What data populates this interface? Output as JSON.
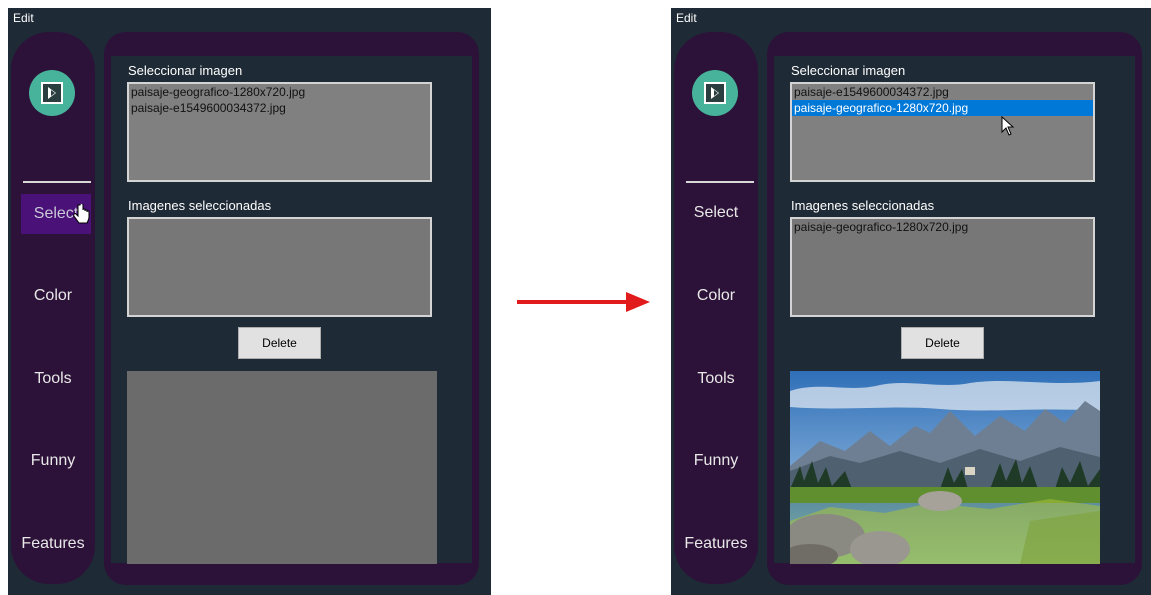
{
  "before": {
    "menu": "Edit",
    "nav": [
      "Select",
      "Color",
      "Tools",
      "Funny",
      "Features"
    ],
    "select_label": "Seleccionar imagen",
    "select_items": [
      "paisaje-geografico-1280x720.jpg",
      "paisaje-e1549600034372.jpg"
    ],
    "selected_label": "Imagenes seleccionadas",
    "selected_items": [],
    "delete_label": "Delete"
  },
  "after": {
    "menu": "Edit",
    "nav": [
      "Select",
      "Color",
      "Tools",
      "Funny",
      "Features"
    ],
    "select_label": "Seleccionar imagen",
    "select_items": [
      "paisaje-e1549600034372.jpg",
      "paisaje-geografico-1280x720.jpg"
    ],
    "highlighted_item": "paisaje-geografico-1280x720.jpg",
    "selected_label": "Imagenes seleccionadas",
    "selected_items": [
      "paisaje-geografico-1280x720.jpg"
    ],
    "delete_label": "Delete"
  },
  "colors": {
    "window_bg": "#1e2a35",
    "panel_purple": "#2c1238",
    "selected_nav": "#4a1179",
    "highlight": "#0078d7",
    "arrow": "#e11b1b"
  },
  "icons": [
    "app-logo-icon",
    "hand-cursor-icon",
    "arrow-cursor-icon",
    "right-arrow-icon"
  ]
}
